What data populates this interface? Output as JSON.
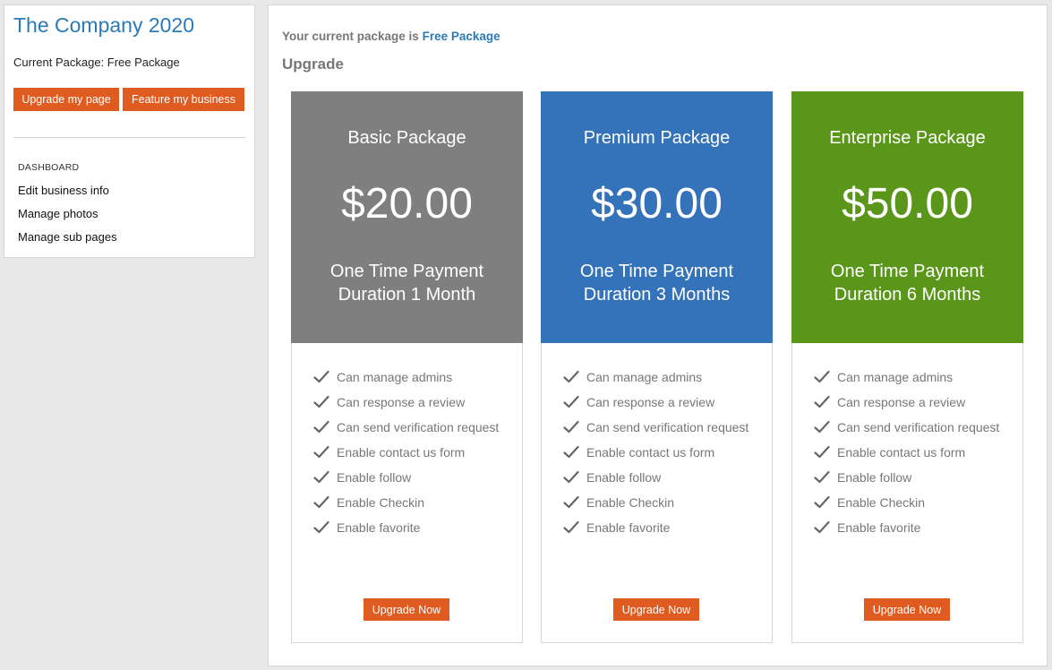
{
  "sidebar": {
    "company_title": "The Company 2020",
    "current_package": "Current Package: Free Package",
    "upgrade_page_label": "Upgrade my page",
    "feature_business_label": "Feature my business",
    "dashboard_heading": "DASHBOARD",
    "links": [
      "Edit business info",
      "Manage photos",
      "Manage sub pages"
    ]
  },
  "main": {
    "current_prefix": "Your current package is",
    "current_package": "Free Package",
    "upgrade_heading": "Upgrade"
  },
  "packages": [
    {
      "name": "Basic Package",
      "price": "$20.00",
      "payment": "One Time Payment",
      "duration": "Duration 1 Month",
      "color": "#7f7f7f",
      "features": [
        "Can manage admins",
        "Can response a review",
        "Can send verification request",
        "Enable contact us form",
        "Enable follow",
        "Enable Checkin",
        "Enable favorite"
      ],
      "button": "Upgrade Now"
    },
    {
      "name": "Premium Package",
      "price": "$30.00",
      "payment": "One Time Payment",
      "duration": "Duration 3 Months",
      "color": "#3472b9",
      "features": [
        "Can manage admins",
        "Can response a review",
        "Can send verification request",
        "Enable contact us form",
        "Enable follow",
        "Enable Checkin",
        "Enable favorite"
      ],
      "button": "Upgrade Now"
    },
    {
      "name": "Enterprise Package",
      "price": "$50.00",
      "payment": "One Time Payment",
      "duration": "Duration 6 Months",
      "color": "#5a961a",
      "features": [
        "Can manage admins",
        "Can response a review",
        "Can send verification request",
        "Enable contact us form",
        "Enable follow",
        "Enable Checkin",
        "Enable favorite"
      ],
      "button": "Upgrade Now"
    }
  ],
  "icons": {
    "feature_check": "check-icon"
  },
  "colors": {
    "accent": "#df5b1f",
    "link": "#2a7ab7"
  }
}
